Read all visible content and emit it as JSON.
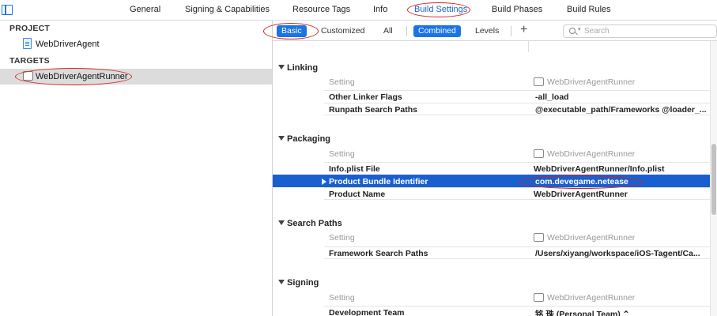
{
  "tabs": {
    "general": "General",
    "signing": "Signing & Capabilities",
    "resource_tags": "Resource Tags",
    "info": "Info",
    "build_settings": "Build Settings",
    "build_phases": "Build Phases",
    "build_rules": "Build Rules"
  },
  "navigator": {
    "project_header": "PROJECT",
    "project_item": "WebDriverAgent",
    "targets_header": "TARGETS",
    "target_item": "WebDriverAgentRunner"
  },
  "filter": {
    "basic": "Basic",
    "customized": "Customized",
    "all": "All",
    "combined": "Combined",
    "levels": "Levels",
    "add": "+",
    "search_placeholder": "Search"
  },
  "sections": {
    "linking": {
      "title": "Linking",
      "header_key": "Setting",
      "header_value": "WebDriverAgentRunner",
      "rows": [
        {
          "key": "Other Linker Flags",
          "value": "-all_load"
        },
        {
          "key": "Runpath Search Paths",
          "value": "@executable_path/Frameworks @loader_..."
        }
      ]
    },
    "packaging": {
      "title": "Packaging",
      "header_key": "Setting",
      "header_value": "WebDriverAgentRunner",
      "rows": [
        {
          "key": "Info.plist File",
          "value": "WebDriverAgentRunner/Info.plist"
        },
        {
          "key": "Product Bundle Identifier",
          "value": "com.devegame.netease"
        },
        {
          "key": "Product Name",
          "value": "WebDriverAgentRunner"
        }
      ]
    },
    "search_paths": {
      "title": "Search Paths",
      "header_key": "Setting",
      "header_value": "WebDriverAgentRunner",
      "rows": [
        {
          "key": "Framework Search Paths",
          "value": "/Users/xiyang/workspace/iOS-Tagent/Ca..."
        }
      ]
    },
    "signing": {
      "title": "Signing",
      "header_key": "Setting",
      "header_value": "WebDriverAgentRunner",
      "rows": [
        {
          "key": "Development Team",
          "value": "铭 珠 (Personal Team) ⌃"
        }
      ]
    }
  },
  "colors": {
    "accent": "#1a73e8",
    "selection": "#1a5fd0",
    "annotation": "#d42020"
  }
}
